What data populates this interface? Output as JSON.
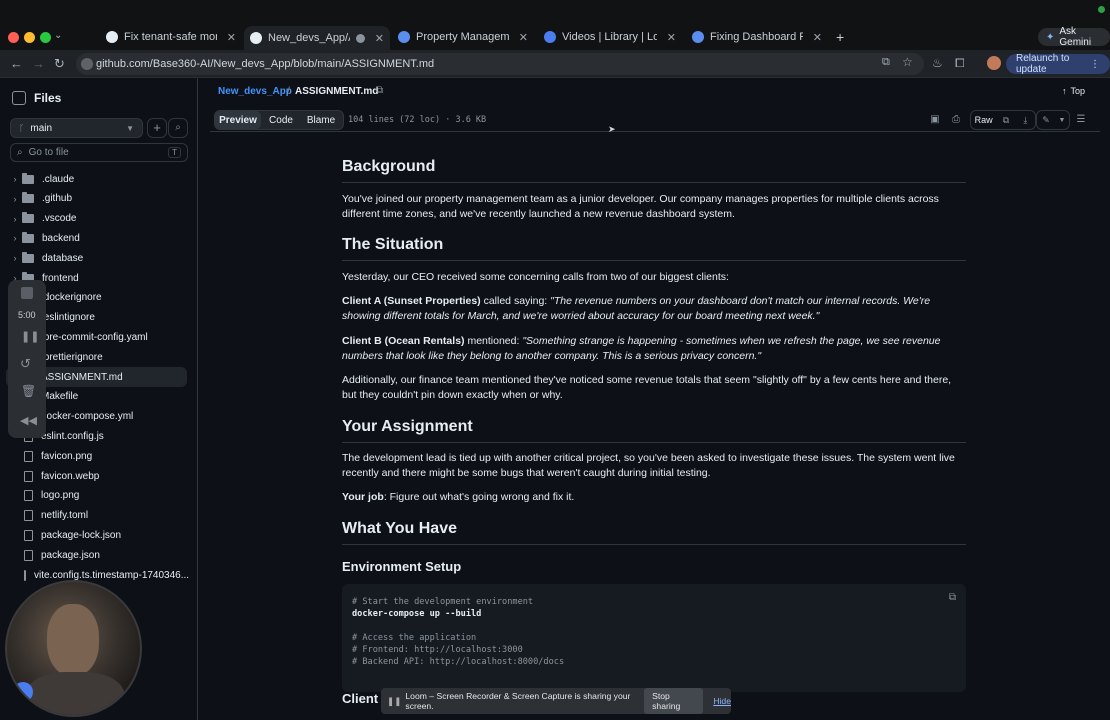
{
  "browser": {
    "tabs": [
      {
        "label": "Fix tenant-safe monthly reve",
        "favicon": "github-icon",
        "color": "#e6edf3"
      },
      {
        "label": "New_devs_App/ASSIGNM",
        "favicon": "github-icon",
        "color": "#e6edf3",
        "active": true
      },
      {
        "label": "Property Management Syster",
        "favicon": "app-icon",
        "color": "#5b8def"
      },
      {
        "label": "Videos | Library | Loom",
        "favicon": "loom-icon",
        "color": "#4a7df0"
      },
      {
        "label": "Fixing Dashboard Revenue M",
        "favicon": "app-icon",
        "color": "#5b8def"
      }
    ],
    "ask_gemini": "Ask Gemini",
    "url": "github.com/Base360-AI/New_devs_App/blob/main/ASSIGNMENT.md",
    "relaunch": "Relaunch to update"
  },
  "files_panel": {
    "title": "Files",
    "branch": "main",
    "go_to_file": "Go to file",
    "shortcut": "T",
    "items": [
      {
        "name": ".claude",
        "type": "folder"
      },
      {
        "name": ".github",
        "type": "folder"
      },
      {
        "name": ".vscode",
        "type": "folder"
      },
      {
        "name": "backend",
        "type": "folder"
      },
      {
        "name": "database",
        "type": "folder"
      },
      {
        "name": "frontend",
        "type": "folder"
      },
      {
        "name": ".dockerignore",
        "type": "file"
      },
      {
        "name": ".eslintignore",
        "type": "file"
      },
      {
        "name": ".pre-commit-config.yaml",
        "type": "file"
      },
      {
        "name": ".prettierignore",
        "type": "file"
      },
      {
        "name": "ASSIGNMENT.md",
        "type": "file",
        "selected": true
      },
      {
        "name": "Makefile",
        "type": "file"
      },
      {
        "name": "docker-compose.yml",
        "type": "file"
      },
      {
        "name": "eslint.config.js",
        "type": "file"
      },
      {
        "name": "favicon.png",
        "type": "file"
      },
      {
        "name": "favicon.webp",
        "type": "file"
      },
      {
        "name": "logo.png",
        "type": "file"
      },
      {
        "name": "netlify.toml",
        "type": "file"
      },
      {
        "name": "package-lock.json",
        "type": "file"
      },
      {
        "name": "package.json",
        "type": "file"
      },
      {
        "name": "vite.config.ts.timestamp-1740346...",
        "type": "file"
      }
    ]
  },
  "loom_toolbar": {
    "timer": "5:00"
  },
  "header": {
    "repo": "New_devs_App",
    "sep": "/",
    "file": "ASSIGNMENT.md",
    "top": "Top",
    "tabs": [
      "Preview",
      "Code",
      "Blame"
    ],
    "meta": "104 lines (72 loc) · 3.6 KB",
    "raw": "Raw"
  },
  "markdown": {
    "background_h": "Background",
    "background_p": "You've joined our property management team as a junior developer. Our company manages properties for multiple clients across different time zones, and we've recently launched a new revenue dashboard system.",
    "situation_h": "The Situation",
    "situation_p": "Yesterday, our CEO received some concerning calls from two of our biggest clients:",
    "client_a_label": "Client A (Sunset Properties)",
    "client_a_said": " called saying: ",
    "client_a_quote": "\"The revenue numbers on your dashboard don't match our internal records. We're showing different totals for March, and we're worried about accuracy for our board meeting next week.\"",
    "client_b_label": "Client B (Ocean Rentals)",
    "client_b_said": " mentioned: ",
    "client_b_quote": "\"Something strange is happening - sometimes when we refresh the page, we see revenue numbers that look like they belong to another company. This is a serious privacy concern.\"",
    "finance_p": "Additionally, our finance team mentioned they've noticed some revenue totals that seem \"slightly off\" by a few cents here and there, but they couldn't pin down exactly when or why.",
    "assignment_h": "Your Assignment",
    "assignment_p": "The development lead is tied up with another critical project, so you've been asked to investigate these issues. The system went live recently and there might be some bugs that weren't caught during initial testing.",
    "job_label": "Your job",
    "job_text": ": Figure out what's going wrong and fix it.",
    "have_h": "What You Have",
    "env_h": "Environment Setup",
    "code_lines": [
      {
        "t": "# Start the development environment",
        "c": true
      },
      {
        "t": "docker-compose up --build",
        "c": false
      },
      {
        "t": "",
        "c": false
      },
      {
        "t": "# Access the application",
        "c": true
      },
      {
        "t": "# Frontend: http://localhost:3000",
        "c": true
      },
      {
        "t": "# Backend API: http://localhost:8000/docs",
        "c": true
      }
    ],
    "client_partial": "Client"
  },
  "loom_share": {
    "text": "Loom – Screen Recorder & Screen Capture is sharing your screen.",
    "stop": "Stop sharing",
    "hide": "Hide"
  }
}
